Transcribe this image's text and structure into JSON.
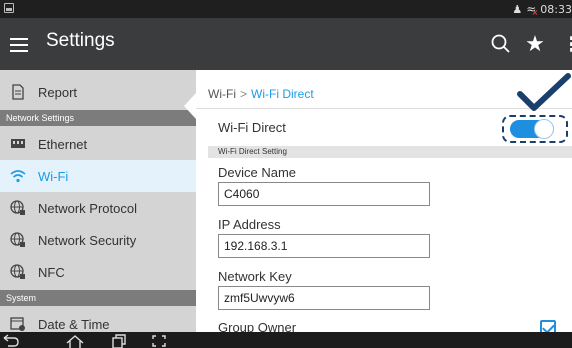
{
  "status_bar": {
    "time": "08:33",
    "icons": [
      "screen-icon",
      "person-icon",
      "wifi-off-icon"
    ]
  },
  "app_bar": {
    "title": "Settings",
    "actions": [
      "search-icon",
      "star-icon",
      "more-vertical-icon"
    ]
  },
  "sidebar": {
    "items": [
      {
        "label": "Report",
        "icon": "report-icon"
      },
      {
        "header": "Network Settings"
      },
      {
        "label": "Ethernet",
        "icon": "ethernet-icon"
      },
      {
        "label": "Wi-Fi",
        "icon": "wifi-icon",
        "active": true
      },
      {
        "label": "Network Protocol",
        "icon": "globe-icon"
      },
      {
        "label": "Network Security",
        "icon": "globe-icon"
      },
      {
        "label": "NFC",
        "icon": "globe-icon"
      },
      {
        "header": "System"
      },
      {
        "label": "Date & Time",
        "icon": "calendar-icon"
      }
    ]
  },
  "main": {
    "breadcrumb": {
      "parent": "Wi-Fi",
      "separator": ">",
      "current": "Wi-Fi Direct"
    },
    "wifi_direct": {
      "label": "Wi-Fi Direct",
      "enabled": true
    },
    "section_header": "Wi-Fi Direct Setting",
    "fields": {
      "device_name": {
        "label": "Device Name",
        "value": "C4060"
      },
      "ip_address": {
        "label": "IP Address",
        "value": "192.168.3.1"
      },
      "network_key": {
        "label": "Network Key",
        "value": "zmf5Uwvyw6"
      }
    },
    "group_owner": {
      "label": "Group Owner",
      "checked": true
    }
  },
  "nav_bar": {
    "buttons": [
      "back-icon",
      "home-icon",
      "recents-icon",
      "screenshot-icon"
    ]
  },
  "colors": {
    "accent": "#1a9ce8",
    "app_bar": "#3b3c3e",
    "sidebar_bg": "#d4d4d4",
    "sidebar_header": "#7c7c7c",
    "highlight_dash": "#1b3f6b"
  }
}
